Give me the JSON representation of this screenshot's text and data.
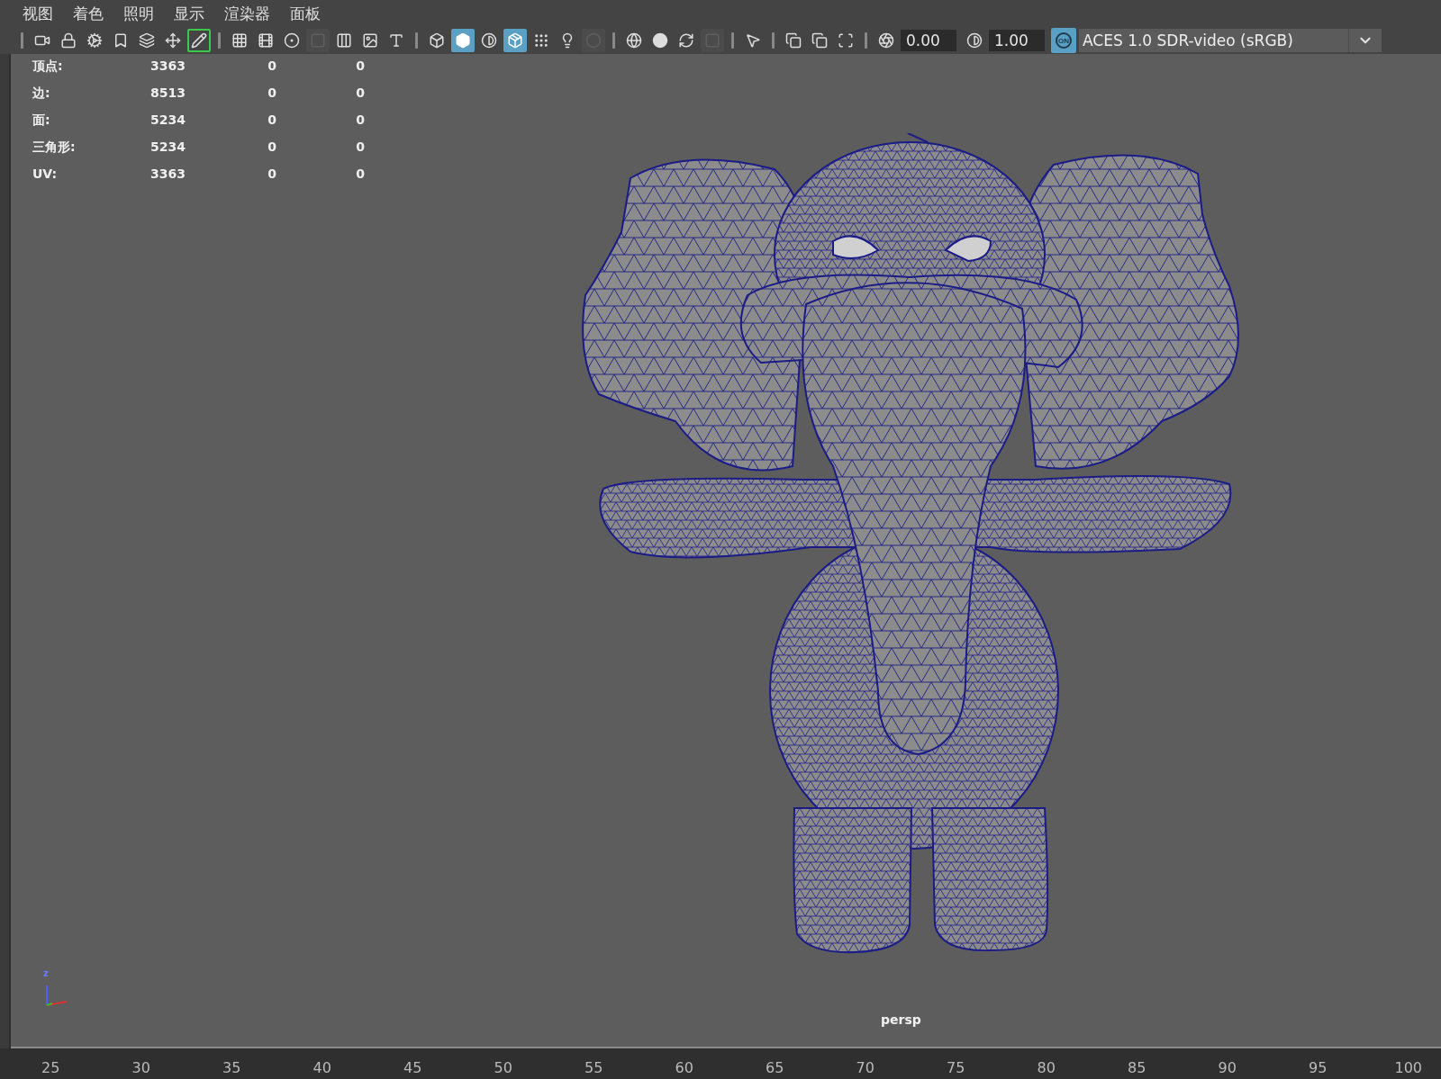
{
  "menu": [
    "视图",
    "着色",
    "照明",
    "显示",
    "渲染器",
    "面板"
  ],
  "toolbar": [
    [
      {
        "kind": "camera",
        "selected": false,
        "disabled": false
      },
      {
        "kind": "camera-lock",
        "selected": false,
        "disabled": false
      },
      {
        "kind": "camera-attr",
        "selected": false,
        "disabled": false
      },
      {
        "kind": "bookmark",
        "selected": false,
        "disabled": false
      },
      {
        "kind": "image-plane",
        "selected": false,
        "disabled": false
      },
      {
        "kind": "pan-zoom",
        "selected": false,
        "disabled": false
      },
      {
        "kind": "pencil",
        "selected": true,
        "disabled": false
      }
    ],
    [
      {
        "kind": "grid",
        "selected": false,
        "disabled": false
      },
      {
        "kind": "film-gate",
        "selected": false,
        "disabled": false
      },
      {
        "kind": "resolution-gate",
        "selected": false,
        "disabled": false
      },
      {
        "kind": "gate-mask",
        "selected": false,
        "disabled": true
      },
      {
        "kind": "field-chart",
        "selected": false,
        "disabled": false
      },
      {
        "kind": "safe-action",
        "selected": false,
        "disabled": false
      },
      {
        "kind": "safe-title",
        "selected": false,
        "disabled": false
      }
    ],
    [
      {
        "kind": "wireframe",
        "selected": false,
        "disabled": false
      },
      {
        "kind": "smooth-shade",
        "selected": true,
        "disabled": false
      },
      {
        "kind": "default-material",
        "selected": false,
        "disabled": false
      },
      {
        "kind": "wireframe-on-shaded",
        "selected": true,
        "disabled": false
      },
      {
        "kind": "textured",
        "selected": false,
        "disabled": false
      },
      {
        "kind": "lights",
        "selected": false,
        "disabled": false
      },
      {
        "kind": "shadows",
        "selected": false,
        "disabled": true
      }
    ],
    [
      {
        "kind": "ambient-occlusion",
        "selected": false,
        "disabled": false
      },
      {
        "kind": "motion-blur",
        "selected": false,
        "disabled": false
      },
      {
        "kind": "anti-alias",
        "selected": false,
        "disabled": false
      },
      {
        "kind": "depth-of-field",
        "selected": false,
        "disabled": true
      }
    ],
    [
      {
        "kind": "isolate-select",
        "selected": false,
        "disabled": false
      }
    ],
    [
      {
        "kind": "xray",
        "selected": false,
        "disabled": false
      },
      {
        "kind": "xray-joints",
        "selected": false,
        "disabled": false
      },
      {
        "kind": "xray-active",
        "selected": false,
        "disabled": false
      }
    ]
  ],
  "exposure": {
    "value": "0.00"
  },
  "gamma": {
    "value": "1.00"
  },
  "color_management": {
    "label": "ON",
    "on": true
  },
  "view_transform": "ACES 1.0 SDR-video (sRGB)",
  "stats": [
    {
      "label": "顶点:",
      "values": [
        "3363",
        "0",
        "0"
      ]
    },
    {
      "label": "边:",
      "values": [
        "8513",
        "0",
        "0"
      ]
    },
    {
      "label": "面:",
      "values": [
        "5234",
        "0",
        "0"
      ]
    },
    {
      "label": "三角形:",
      "values": [
        "5234",
        "0",
        "0"
      ]
    },
    {
      "label": "UV:",
      "values": [
        "3363",
        "0",
        "0"
      ]
    }
  ],
  "axis_label": "z",
  "camera": "persp",
  "timeline": [
    "25",
    "30",
    "35",
    "40",
    "45",
    "50",
    "55",
    "60",
    "65",
    "70",
    "75",
    "80",
    "85",
    "90",
    "95",
    "100"
  ]
}
